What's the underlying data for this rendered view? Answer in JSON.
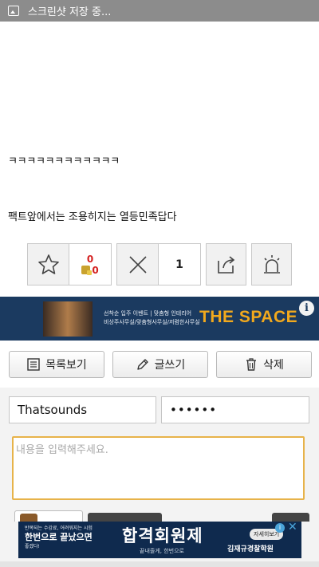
{
  "statusbar": {
    "icon": "image-icon",
    "text": "스크린샷 저장 중..."
  },
  "post": {
    "line1": "ㅋㅋㅋㅋㅋㅋㅋㅋㅋㅋㅋㅋ",
    "line2": "팩트앞에서는 조용히지는 열등민족답다"
  },
  "actions": {
    "like_count": "0",
    "bookmark_count": "0",
    "dislike_count": "1"
  },
  "ad_top": {
    "line1": "선착순 입주 이벤트 | 맞춤형 인테리어",
    "line2": "비상주사무실/맞춤형사무실/저렴한사무실",
    "brand": "THE SPACE",
    "info": "i"
  },
  "toolbar": {
    "list_label": "목록보기",
    "write_label": "글쓰기",
    "delete_label": "삭제"
  },
  "form": {
    "name_value": "Thatsounds",
    "password_value": "••••••",
    "content_placeholder": "내용을 입력해주세요."
  },
  "ad_bottom": {
    "small": "반복되는 수강료, 어려워지는 시험",
    "big": "한번으로 끝났으면",
    "small2": "좋겠다!",
    "headline": "합격회원제",
    "sub": "끝내줄게, 한번으로",
    "detail": "자세히보기",
    "school": "김재규경찰학원",
    "info": "i",
    "close": "✕"
  }
}
